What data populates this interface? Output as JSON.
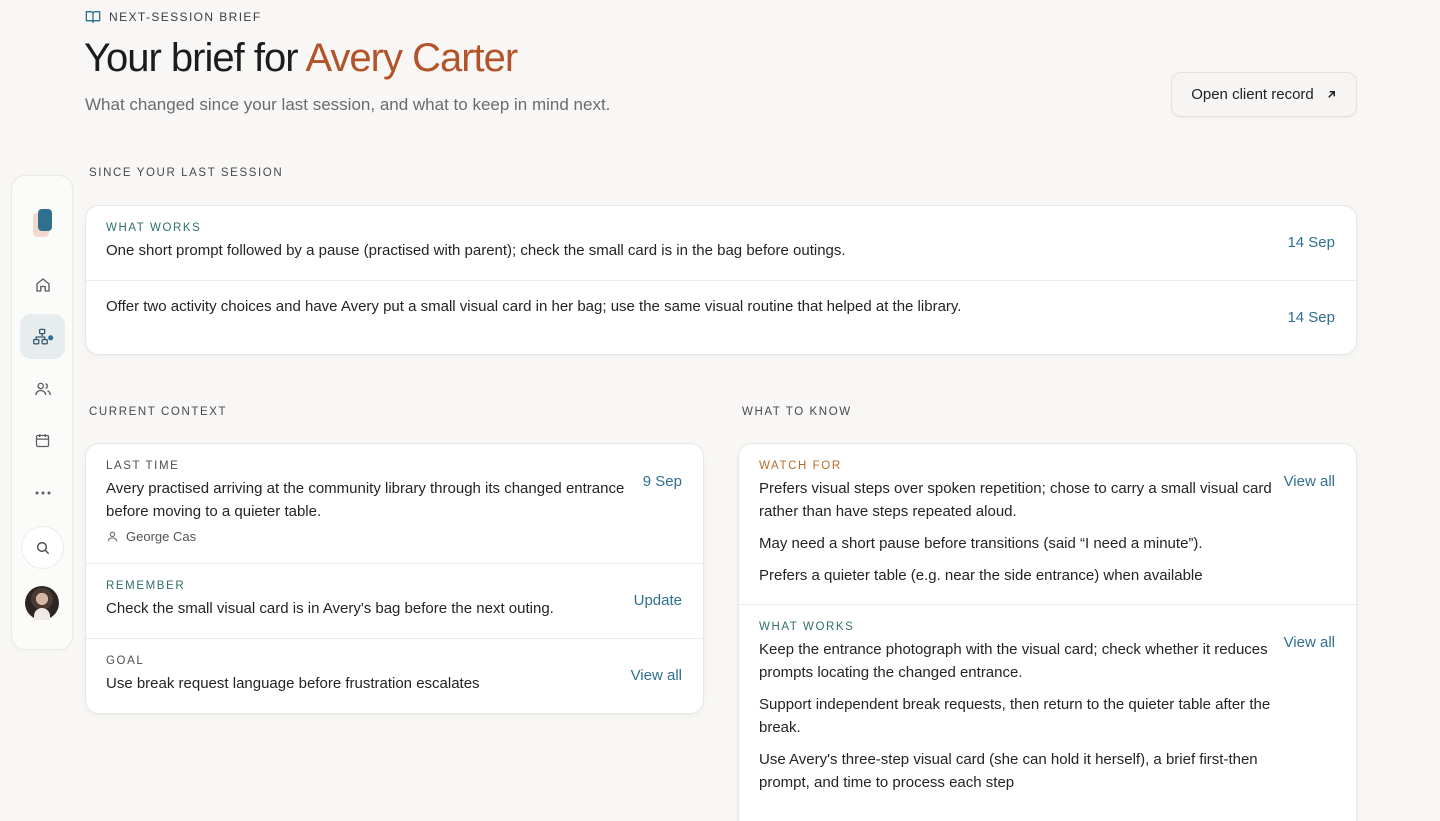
{
  "header": {
    "eyebrow": "NEXT-SESSION BRIEF",
    "title_prefix": "Your brief for ",
    "client_name": "Avery Carter",
    "subtitle": "What changed since your last session, and what to keep in mind next.",
    "open_record_label": "Open client record"
  },
  "since_last": {
    "label": "SINCE YOUR LAST SESSION",
    "rows": [
      {
        "kicker": "WHAT WORKS",
        "text": "One short prompt followed by a pause (practised with parent); check the small card is in the bag before outings.",
        "date": "14 Sep"
      },
      {
        "text": "Offer two activity choices and have Avery put a small visual card in her bag; use the same visual routine that helped at the library.",
        "date": "14 Sep"
      }
    ]
  },
  "current_context": {
    "label": "CURRENT CONTEXT",
    "last_time": {
      "kicker": "LAST TIME",
      "text": "Avery practised arriving at the community library through its changed entrance before moving to a quieter table.",
      "date": "9 Sep",
      "author": "George Cas"
    },
    "remember": {
      "kicker": "REMEMBER",
      "text": "Check the small visual card is in Avery's bag before the next outing.",
      "action": "Update"
    },
    "goal": {
      "kicker": "GOAL",
      "text": "Use break request language before frustration escalates",
      "action": "View all"
    }
  },
  "what_to_know": {
    "label": "WHAT TO KNOW",
    "watch_for": {
      "kicker": "WATCH FOR",
      "action": "View all",
      "items": [
        "Prefers visual steps over spoken repetition; chose to carry a small visual card rather than have steps repeated aloud.",
        "May need a short pause before transitions (said “I need a minute”).",
        "Prefers a quieter table (e.g. near the side entrance) when available"
      ]
    },
    "what_works": {
      "kicker": "WHAT WORKS",
      "action": "View all",
      "items": [
        "Keep the entrance photograph with the visual card; check whether it reduces prompts locating the changed entrance.",
        "Support independent break requests, then return to the quieter table after the break.",
        "Use Avery's three-step visual card (she can hold it herself), a brief first-then prompt, and time to process each step"
      ]
    }
  },
  "colors": {
    "accent": "#2f6f8f",
    "name": "#b2532a",
    "teal_kicker": "#2f6f6a",
    "orange_kicker": "#b96b2a"
  },
  "icons": [
    "book-open-icon",
    "home-icon",
    "network-icon",
    "users-icon",
    "calendar-icon",
    "more-icon",
    "search-icon",
    "arrow-up-right-icon",
    "user-icon"
  ]
}
